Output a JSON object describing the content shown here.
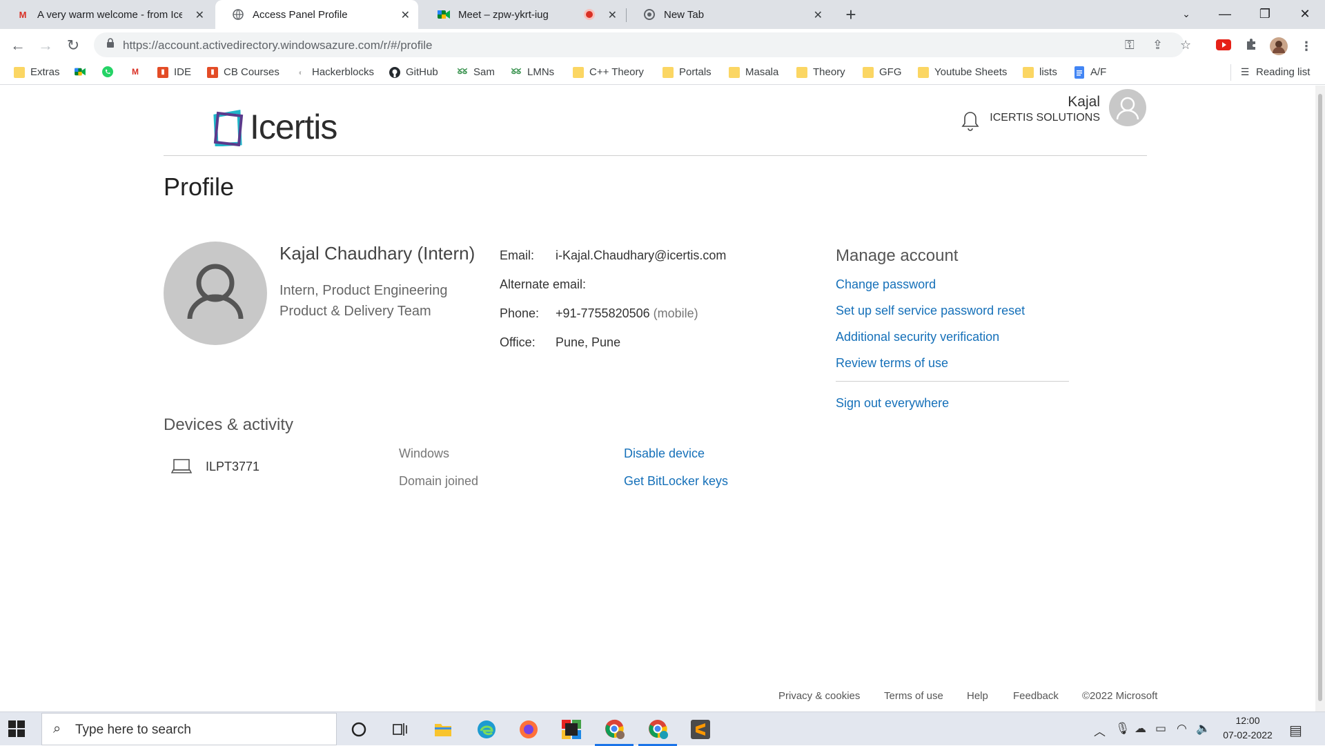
{
  "browser": {
    "tabs": [
      {
        "title": "A very warm welcome - from Icer",
        "icon": "gmail-icon",
        "active": false
      },
      {
        "title": "Access Panel Profile",
        "icon": "globe-icon",
        "active": true
      },
      {
        "title": "Meet – zpw-ykrt-iug",
        "icon": "meet-icon",
        "active": false,
        "recording": true
      },
      {
        "title": "New Tab",
        "icon": "chrome-icon",
        "active": false
      }
    ],
    "url": "https://account.activedirectory.windowsazure.com/r/#/profile",
    "bookmarks": [
      {
        "label": "Extras",
        "icon": "folder-icon"
      },
      {
        "label": "",
        "icon": "meet-icon"
      },
      {
        "label": "",
        "icon": "whatsapp-icon"
      },
      {
        "label": "",
        "icon": "gmail-icon"
      },
      {
        "label": "IDE",
        "icon": "codingblocks-icon"
      },
      {
        "label": "CB Courses",
        "icon": "codingblocks-icon"
      },
      {
        "label": "Hackerblocks",
        "icon": "hackerblocks-icon"
      },
      {
        "label": "GitHub",
        "icon": "github-icon"
      },
      {
        "label": "Sam",
        "icon": "gfg-icon"
      },
      {
        "label": "LMNs",
        "icon": "gfg-icon"
      },
      {
        "label": "C++ Theory",
        "icon": "folder-icon"
      },
      {
        "label": "Portals",
        "icon": "folder-icon"
      },
      {
        "label": "Masala",
        "icon": "folder-icon"
      },
      {
        "label": "Theory",
        "icon": "folder-icon"
      },
      {
        "label": "GFG",
        "icon": "folder-icon"
      },
      {
        "label": "Youtube Sheets",
        "icon": "folder-icon"
      },
      {
        "label": "lists",
        "icon": "folder-icon"
      },
      {
        "label": "A/F",
        "icon": "docs-icon"
      }
    ],
    "reading_list": "Reading list"
  },
  "header": {
    "brand": "Icertis",
    "user_name": "Kajal",
    "user_org": "ICERTIS SOLUTIONS"
  },
  "page": {
    "title": "Profile"
  },
  "profile": {
    "name": "Kajal Chaudhary (Intern)",
    "role": "Intern, Product Engineering",
    "team": "Product & Delivery Team"
  },
  "contact": {
    "email_label": "Email:",
    "email_value": "i-Kajal.Chaudhary@icertis.com",
    "alt_email_label": "Alternate email:",
    "phone_label": "Phone:",
    "phone_value": "+91-7755820506",
    "phone_type": "(mobile)",
    "office_label": "Office:",
    "office_value": "Pune, Pune"
  },
  "manage": {
    "heading": "Manage account",
    "links": [
      "Change password",
      "Set up self service password reset",
      "Additional security verification",
      "Review terms of use"
    ],
    "sign_out": "Sign out everywhere"
  },
  "devices": {
    "heading": "Devices & activity",
    "device_name": "ILPT3771",
    "os": "Windows",
    "join_type": "Domain joined",
    "disable_link": "Disable device",
    "bitlocker_link": "Get BitLocker keys"
  },
  "footer": {
    "privacy": "Privacy & cookies",
    "terms": "Terms of use",
    "help": "Help",
    "feedback": "Feedback",
    "copyright": "©2022 Microsoft"
  },
  "taskbar": {
    "search_placeholder": "Type here to search",
    "time": "12:00",
    "date": "07-02-2022"
  },
  "colors": {
    "link": "#1570b9",
    "logo_teal": "#1fb5c8",
    "logo_purple": "#5b3a8c",
    "taskbar": "#e3e7ef"
  }
}
